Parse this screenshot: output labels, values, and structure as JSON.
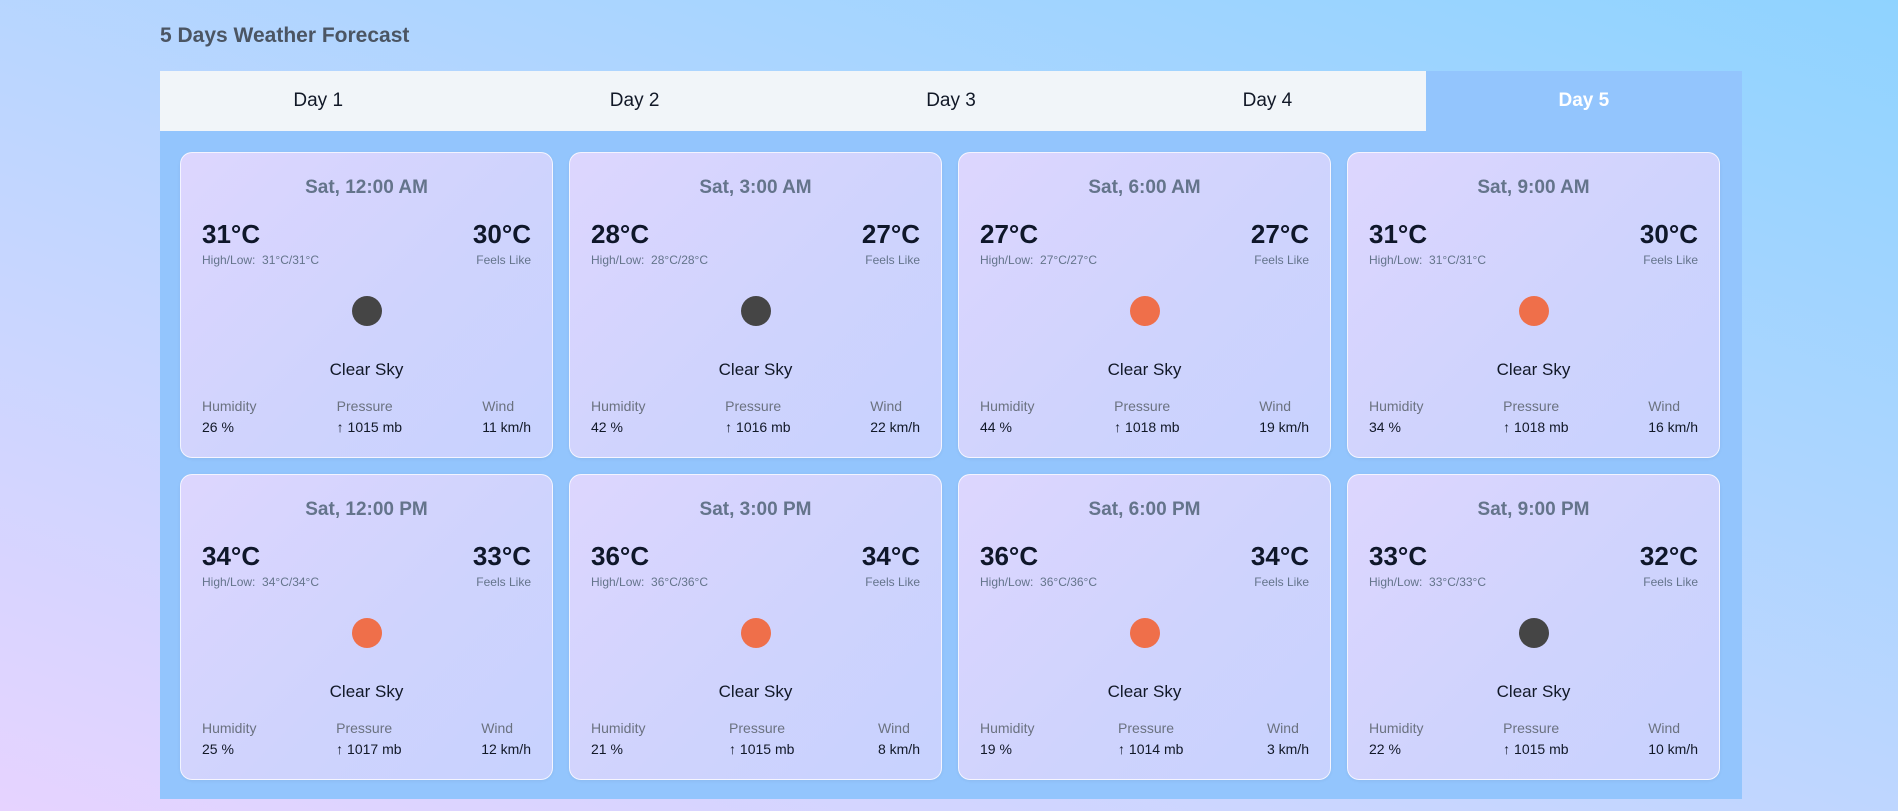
{
  "page": {
    "title": "5 Days Weather Forecast"
  },
  "tabs": [
    {
      "label": "Day 1",
      "active": false
    },
    {
      "label": "Day 2",
      "active": false
    },
    {
      "label": "Day 3",
      "active": false
    },
    {
      "label": "Day 4",
      "active": false
    },
    {
      "label": "Day 5",
      "active": true
    }
  ],
  "labels": {
    "high_low": "High/Low:",
    "feels_like": "Feels Like",
    "humidity": "Humidity",
    "pressure": "Pressure",
    "wind": "Wind"
  },
  "colors": {
    "night_icon": "#454545",
    "day_icon": "#ef6f4a",
    "active_tab": "#93c5fd"
  },
  "cards": [
    {
      "time": "Sat, 12:00 AM",
      "temp": "31°C",
      "high_low": "31°C/31°C",
      "feels": "30°C",
      "icon": "moon-icon",
      "condition": "Clear Sky",
      "humidity": "26 %",
      "pressure": "↑ 1015 mb",
      "wind": "11 km/h"
    },
    {
      "time": "Sat, 3:00 AM",
      "temp": "28°C",
      "high_low": "28°C/28°C",
      "feels": "27°C",
      "icon": "moon-icon",
      "condition": "Clear Sky",
      "humidity": "42 %",
      "pressure": "↑ 1016 mb",
      "wind": "22 km/h"
    },
    {
      "time": "Sat, 6:00 AM",
      "temp": "27°C",
      "high_low": "27°C/27°C",
      "feels": "27°C",
      "icon": "sun-icon",
      "condition": "Clear Sky",
      "humidity": "44 %",
      "pressure": "↑ 1018 mb",
      "wind": "19 km/h"
    },
    {
      "time": "Sat, 9:00 AM",
      "temp": "31°C",
      "high_low": "31°C/31°C",
      "feels": "30°C",
      "icon": "sun-icon",
      "condition": "Clear Sky",
      "humidity": "34 %",
      "pressure": "↑ 1018 mb",
      "wind": "16 km/h"
    },
    {
      "time": "Sat, 12:00 PM",
      "temp": "34°C",
      "high_low": "34°C/34°C",
      "feels": "33°C",
      "icon": "sun-icon",
      "condition": "Clear Sky",
      "humidity": "25 %",
      "pressure": "↑ 1017 mb",
      "wind": "12 km/h"
    },
    {
      "time": "Sat, 3:00 PM",
      "temp": "36°C",
      "high_low": "36°C/36°C",
      "feels": "34°C",
      "icon": "sun-icon",
      "condition": "Clear Sky",
      "humidity": "21 %",
      "pressure": "↑ 1015 mb",
      "wind": "8 km/h"
    },
    {
      "time": "Sat, 6:00 PM",
      "temp": "36°C",
      "high_low": "36°C/36°C",
      "feels": "34°C",
      "icon": "sun-icon",
      "condition": "Clear Sky",
      "humidity": "19 %",
      "pressure": "↑ 1014 mb",
      "wind": "3 km/h"
    },
    {
      "time": "Sat, 9:00 PM",
      "temp": "33°C",
      "high_low": "33°C/33°C",
      "feels": "32°C",
      "icon": "moon-icon",
      "condition": "Clear Sky",
      "humidity": "22 %",
      "pressure": "↑ 1015 mb",
      "wind": "10 km/h"
    }
  ]
}
